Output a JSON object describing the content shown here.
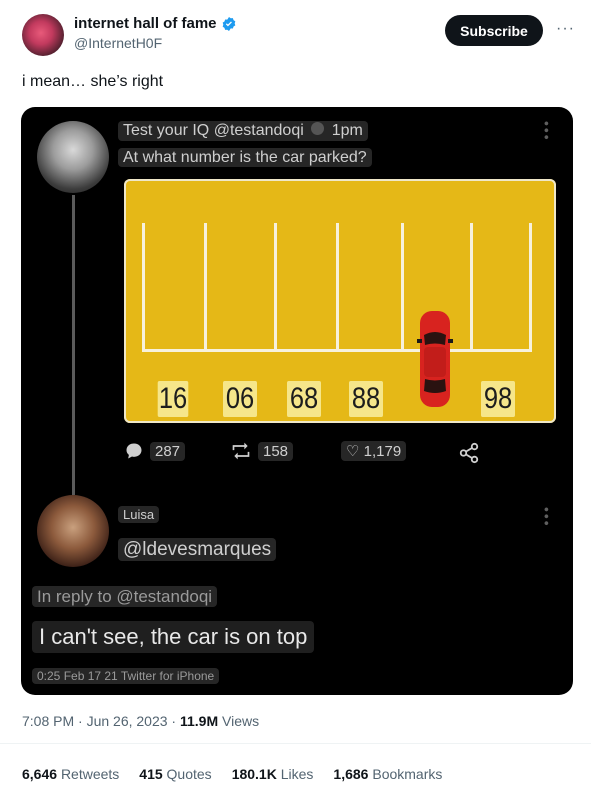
{
  "author": {
    "name": "internet hall of fame",
    "handle": "@InternetH0F"
  },
  "subscribe_label": "Subscribe",
  "more_label": "···",
  "tweet_text": "i mean… she’s right",
  "embedded": {
    "quiz_line1_prefix": "Test your IQ @testandoqi",
    "quiz_time": "1pm",
    "quiz_line2": "At what number is the car parked?",
    "parking_numbers": [
      "16",
      "06",
      "68",
      "88",
      "98"
    ],
    "actions": {
      "replies": "287",
      "retweets": "158",
      "likes": "1,179"
    },
    "reply": {
      "name": "Luisa",
      "handle": "@ldevesmarques",
      "in_reply_to": "In reply to @testandoqi",
      "text": "I can't see, the car is on top",
      "meta": "0:25 Feb 17 21 Twitter for iPhone"
    }
  },
  "timestamp": {
    "time": "7:08 PM · Jun 26, 2023 ·",
    "views_count": "11.9M",
    "views_label": "Views"
  },
  "stats": {
    "retweets_count": "6,646",
    "retweets_label": "Retweets",
    "quotes_count": "415",
    "quotes_label": "Quotes",
    "likes_count": "180.1K",
    "likes_label": "Likes",
    "bookmarks_count": "1,686",
    "bookmarks_label": "Bookmarks"
  },
  "colors": {
    "verified_badge": "#1d9bf0",
    "subscribe_bg": "#0f1419",
    "puzzle_yellow": "#e5b817",
    "car_red": "#d8231f"
  }
}
